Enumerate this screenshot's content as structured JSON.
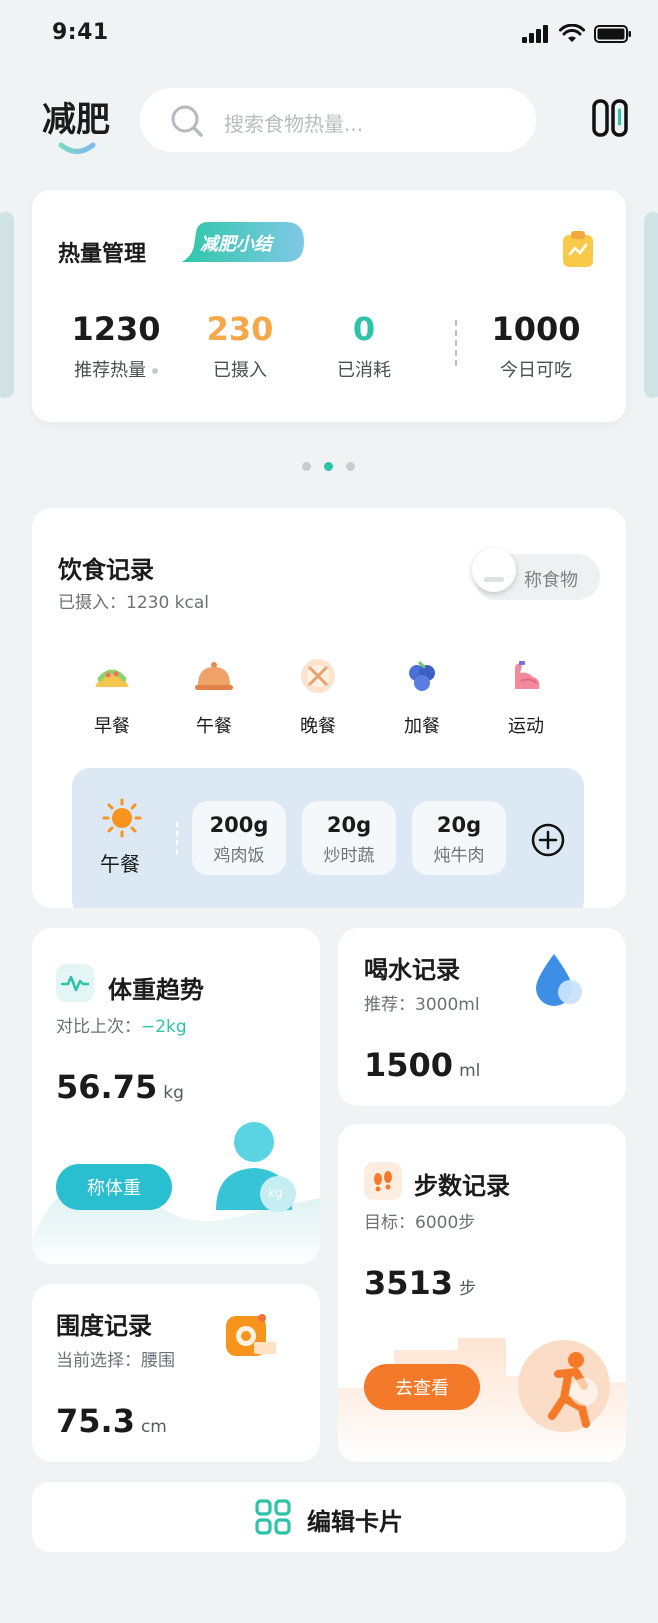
{
  "status_bar": {
    "time": "9:41"
  },
  "header": {
    "brand": "减肥",
    "search_placeholder": "搜索食物热量..."
  },
  "calorie_card": {
    "title": "热量管理",
    "tag": "减肥小结",
    "stats": [
      {
        "value": "1230",
        "label": "推荐热量",
        "color": "#1b1b1b"
      },
      {
        "value": "230",
        "label": "已摄入",
        "color": "#f5a84a"
      },
      {
        "value": "0",
        "label": "已消耗",
        "color": "#2cc3a7"
      },
      {
        "value": "1000",
        "label": "今日可吃",
        "color": "#1b1b1b"
      }
    ]
  },
  "carousel": {
    "count": 3,
    "active": 2
  },
  "diet": {
    "title": "饮食记录",
    "subtitle": "已摄入：1230 kcal",
    "weigh_label": "称食物",
    "meals": [
      "早餐",
      "午餐",
      "晚餐",
      "加餐",
      "运动"
    ],
    "current_meal": "午餐",
    "foods": [
      {
        "weight": "200g",
        "name": "鸡肉饭"
      },
      {
        "weight": "20g",
        "name": "炒时蔬"
      },
      {
        "weight": "20g",
        "name": "炖牛肉"
      }
    ]
  },
  "weight": {
    "title": "体重趋势",
    "compare_label": "对比上次：",
    "compare_value": "−2kg",
    "value": "56.75",
    "unit": "kg",
    "button": "称体重",
    "badge": "kg"
  },
  "water": {
    "title": "喝水记录",
    "subtitle": "推荐：3000ml",
    "value": "1500",
    "unit": "ml"
  },
  "steps": {
    "title": "步数记录",
    "subtitle": "目标：6000步",
    "value": "3513",
    "unit": "步",
    "button": "去查看"
  },
  "girth": {
    "title": "围度记录",
    "subtitle": "当前选择：腰围",
    "value": "75.3",
    "unit": "cm"
  },
  "edit": {
    "label": "编辑卡片"
  },
  "colors": {
    "accent": "#2cc3a7",
    "orange": "#f5a84a",
    "step_orange": "#f47a2a",
    "weight_teal": "#2abfd0"
  }
}
